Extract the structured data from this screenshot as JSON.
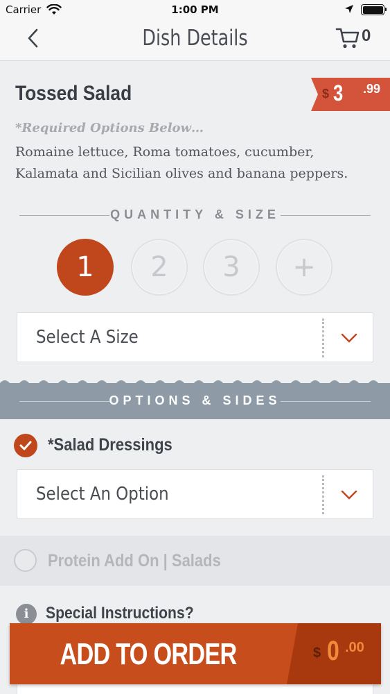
{
  "status_bar": {
    "carrier": "Carrier",
    "time": "1:00 PM"
  },
  "nav": {
    "title": "Dish Details",
    "cart_count": "0"
  },
  "dish": {
    "name": "Tossed Salad",
    "price_symbol": "$",
    "price_whole": "3",
    "price_cents": ".99",
    "required_note": "*Required Options Below…",
    "description": "Romaine lettuce, Roma tomatoes, cucumber, Kalamata and Sicilian olives and banana peppers."
  },
  "quantity": {
    "heading": "QUANTITY & SIZE",
    "options": [
      "1",
      "2",
      "3",
      "+"
    ],
    "selected": "1",
    "size_placeholder": "Select A Size"
  },
  "options": {
    "heading": "OPTIONS & SIDES",
    "dressing_label": "*Salad Dressings",
    "dressing_placeholder": "Select An Option",
    "protein_label": "Protein Add On | Salads"
  },
  "special": {
    "label": "Special Instructions?"
  },
  "order_button": {
    "label": "ADD TO ORDER",
    "total_symbol": "$",
    "total_whole": "0",
    "total_cents": ".00"
  },
  "colors": {
    "accent": "#c0461b",
    "price_tag": "#d4543b",
    "band": "#8e9ba6"
  }
}
